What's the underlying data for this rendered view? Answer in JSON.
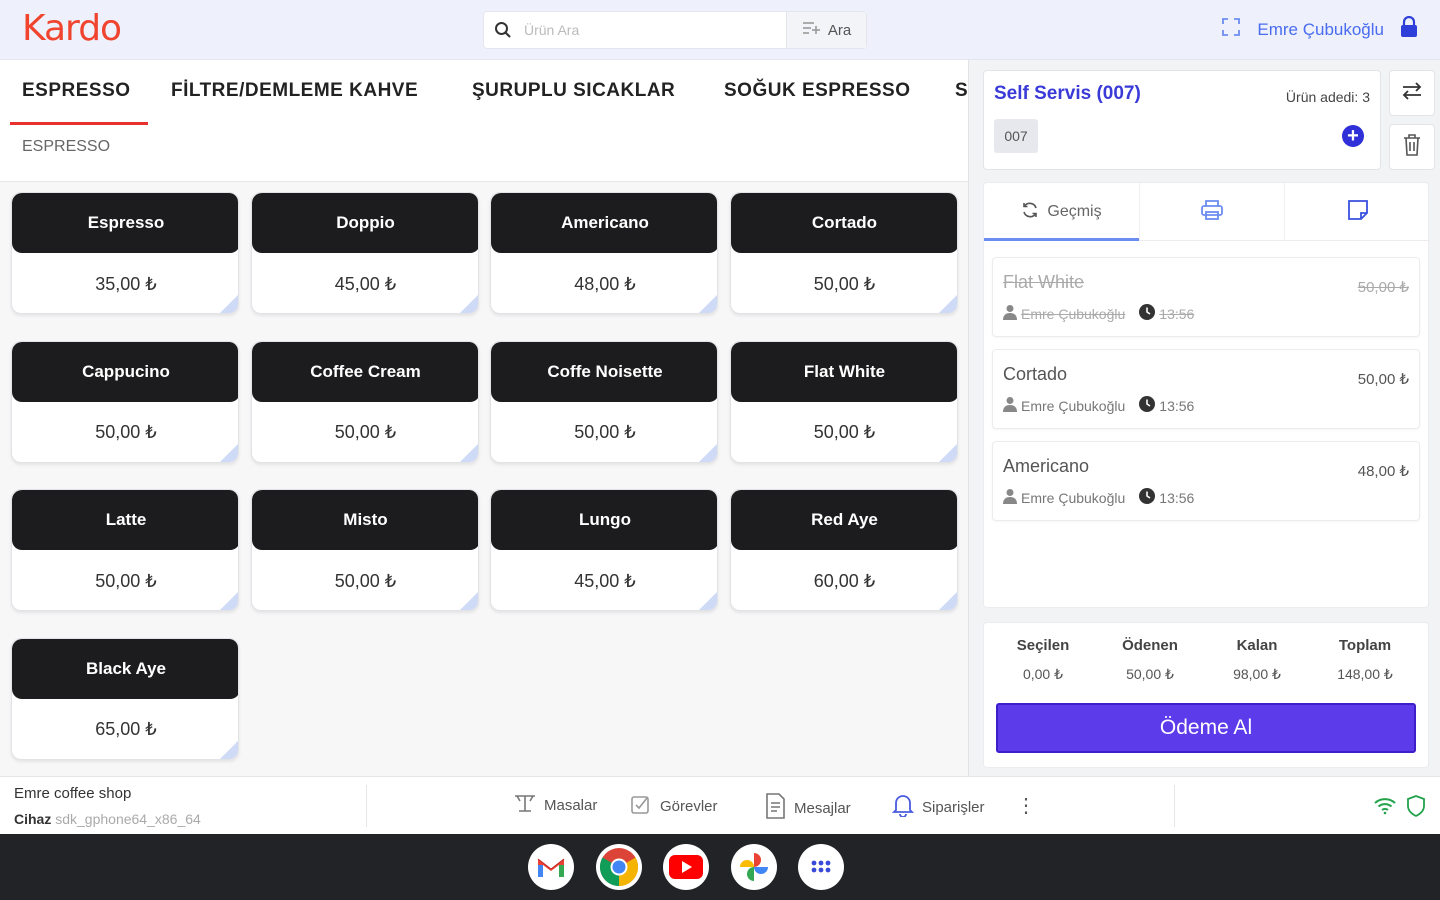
{
  "header": {
    "logo": "Kardo",
    "search_placeholder": "Ürün Ara",
    "search_button": "Ara",
    "user_name": "Emre Çubukoğlu"
  },
  "tabs": [
    "ESPRESSO",
    "FİLTRE/DEMLEME KAHVE",
    "ŞURUPLU SICAKLAR",
    "SOĞUK ESPRESSO",
    "S"
  ],
  "subcategory": "ESPRESSO",
  "products": [
    {
      "name": "Espresso",
      "price": "35,00 ₺"
    },
    {
      "name": "Doppio",
      "price": "45,00 ₺"
    },
    {
      "name": "Americano",
      "price": "48,00 ₺"
    },
    {
      "name": "Cortado",
      "price": "50,00 ₺"
    },
    {
      "name": "Cappucino",
      "price": "50,00 ₺"
    },
    {
      "name": "Coffee Cream",
      "price": "50,00 ₺"
    },
    {
      "name": "Coffe Noisette",
      "price": "50,00 ₺"
    },
    {
      "name": "Flat White",
      "price": "50,00 ₺"
    },
    {
      "name": "Latte",
      "price": "50,00 ₺"
    },
    {
      "name": "Misto",
      "price": "50,00 ₺"
    },
    {
      "name": "Lungo",
      "price": "45,00 ₺"
    },
    {
      "name": "Red Aye",
      "price": "60,00 ₺"
    },
    {
      "name": "Black Aye",
      "price": "65,00 ₺"
    }
  ],
  "order": {
    "title": "Self Servis (007)",
    "count_label": "Ürün adedi:",
    "count": "3",
    "code": "007"
  },
  "history_tab": "Geçmiş",
  "order_items": [
    {
      "name": "Flat White",
      "price": "50,00 ₺",
      "user": "Emre Çubukoğlu",
      "time": "13:56",
      "cancelled": true
    },
    {
      "name": "Cortado",
      "price": "50,00 ₺",
      "user": "Emre Çubukoğlu",
      "time": "13:56",
      "cancelled": false
    },
    {
      "name": "Americano",
      "price": "48,00 ₺",
      "user": "Emre Çubukoğlu",
      "time": "13:56",
      "cancelled": false
    }
  ],
  "totals": [
    {
      "label": "Seçilen",
      "value": "0,00 ₺"
    },
    {
      "label": "Ödenen",
      "value": "50,00 ₺"
    },
    {
      "label": "Kalan",
      "value": "98,00 ₺"
    },
    {
      "label": "Toplam",
      "value": "148,00 ₺"
    }
  ],
  "pay_button": "Ödeme Al",
  "footer": {
    "shop": "Emre coffee shop",
    "device_label": "Cihaz",
    "device_value": "sdk_gphone64_x86_64",
    "nav": [
      "Masalar",
      "Görevler",
      "Mesajlar",
      "Siparişler"
    ]
  },
  "colors": {
    "brand": "#f0442f",
    "accent": "#5b3bea",
    "card_dark": "#1c1c1e",
    "link": "#4a6cf0"
  },
  "taskbar_apps": [
    "gmail-icon",
    "chrome-icon",
    "youtube-icon",
    "photos-icon",
    "app-drawer-icon"
  ]
}
